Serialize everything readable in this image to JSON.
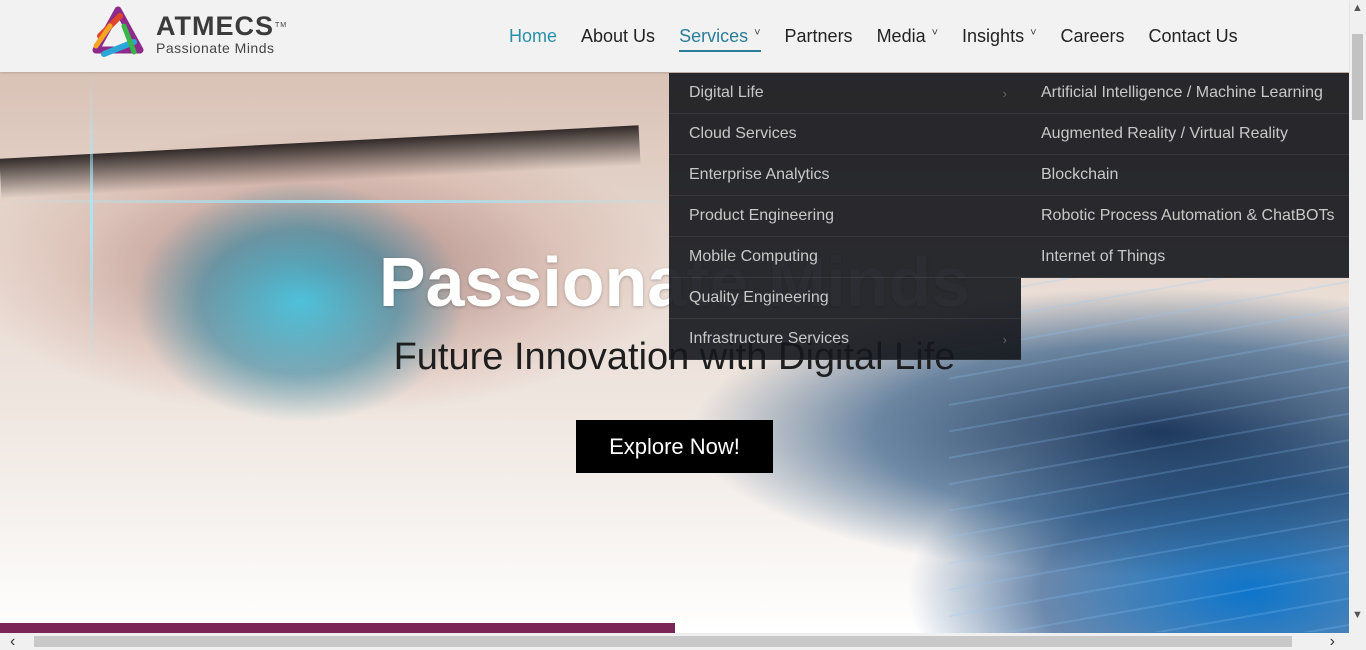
{
  "header": {
    "brand": "ATMECS",
    "trademark": "TM",
    "tagline": "Passionate Minds",
    "nav": [
      {
        "label": "Home",
        "chevron": false
      },
      {
        "label": "About Us",
        "chevron": false
      },
      {
        "label": "Services",
        "chevron": true
      },
      {
        "label": "Partners",
        "chevron": false
      },
      {
        "label": "Media",
        "chevron": true
      },
      {
        "label": "Insights",
        "chevron": true
      },
      {
        "label": "Careers",
        "chevron": false
      },
      {
        "label": "Contact Us",
        "chevron": false
      }
    ],
    "active_color": "#2a8fa8"
  },
  "services_menu": {
    "left": [
      {
        "label": "Digital Life",
        "has_submenu": true
      },
      {
        "label": "Cloud Services",
        "has_submenu": false
      },
      {
        "label": "Enterprise Analytics",
        "has_submenu": false
      },
      {
        "label": "Product Engineering",
        "has_submenu": false
      },
      {
        "label": "Mobile Computing",
        "has_submenu": false
      },
      {
        "label": "Quality Engineering",
        "has_submenu": false
      },
      {
        "label": "Infrastructure Services",
        "has_submenu": true
      }
    ],
    "right": [
      {
        "label": "Artificial Intelligence / Machine Learning"
      },
      {
        "label": "Augmented Reality / Virtual Reality"
      },
      {
        "label": "Blockchain"
      },
      {
        "label": "Robotic Process Automation & ChatBOTs"
      },
      {
        "label": "Internet of Things"
      }
    ]
  },
  "hero": {
    "title": "Passionate Minds",
    "subtitle": "Future Innovation with Digital Life",
    "cta": "Explore Now!",
    "slide_progress": 0.5,
    "progress_color": "#7b2456"
  },
  "icons": {
    "chevron": "chevron-down-icon",
    "submenu_arrow": "chevron-right-icon",
    "scroll_up": "arrow-up-icon",
    "scroll_down": "arrow-down-icon",
    "scroll_left": "arrow-left-icon",
    "scroll_right": "arrow-right-icon"
  },
  "glyphs": {
    "chevron": "˅",
    "submenu_arrow": "›",
    "scroll_up": "▲",
    "scroll_down": "▼",
    "scroll_left": "‹",
    "scroll_right": "›"
  }
}
